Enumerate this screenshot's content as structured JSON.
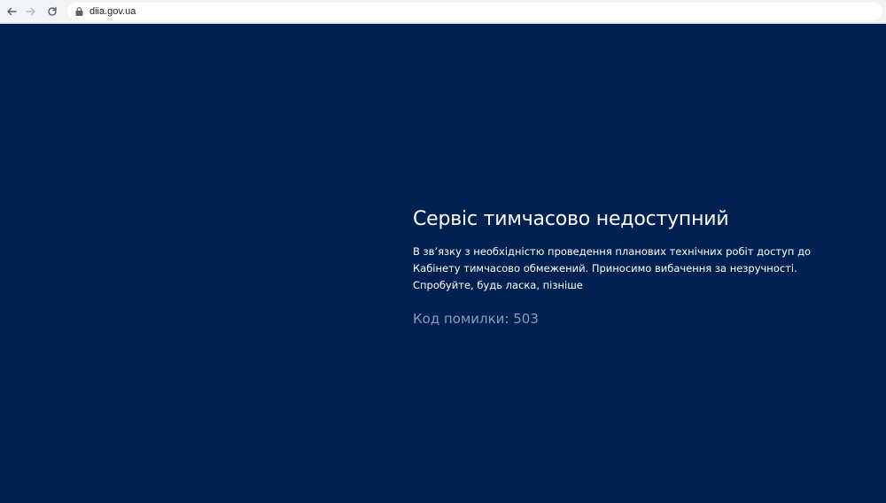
{
  "browser": {
    "url": "diia.gov.ua",
    "back_icon": "arrow-left-icon",
    "forward_icon": "arrow-right-icon",
    "reload_icon": "reload-icon",
    "lock_icon": "lock-icon"
  },
  "page": {
    "title": "Сервіс тимчасово недоступний",
    "description_lines": [
      "В зв’язку з необхідністю проведення планових технічних робіт доступ до",
      "Кабінету тимчасово обмежений. Приносимо вибачення за незручності.",
      "Спробуйте, будь ласка, пізніше"
    ],
    "error_code": "Код помилки: 503"
  },
  "colors": {
    "background": "#012152",
    "title_text": "#ffffff",
    "error_text": "#8d9bb5",
    "browser_bar": "#f1f3f4"
  }
}
